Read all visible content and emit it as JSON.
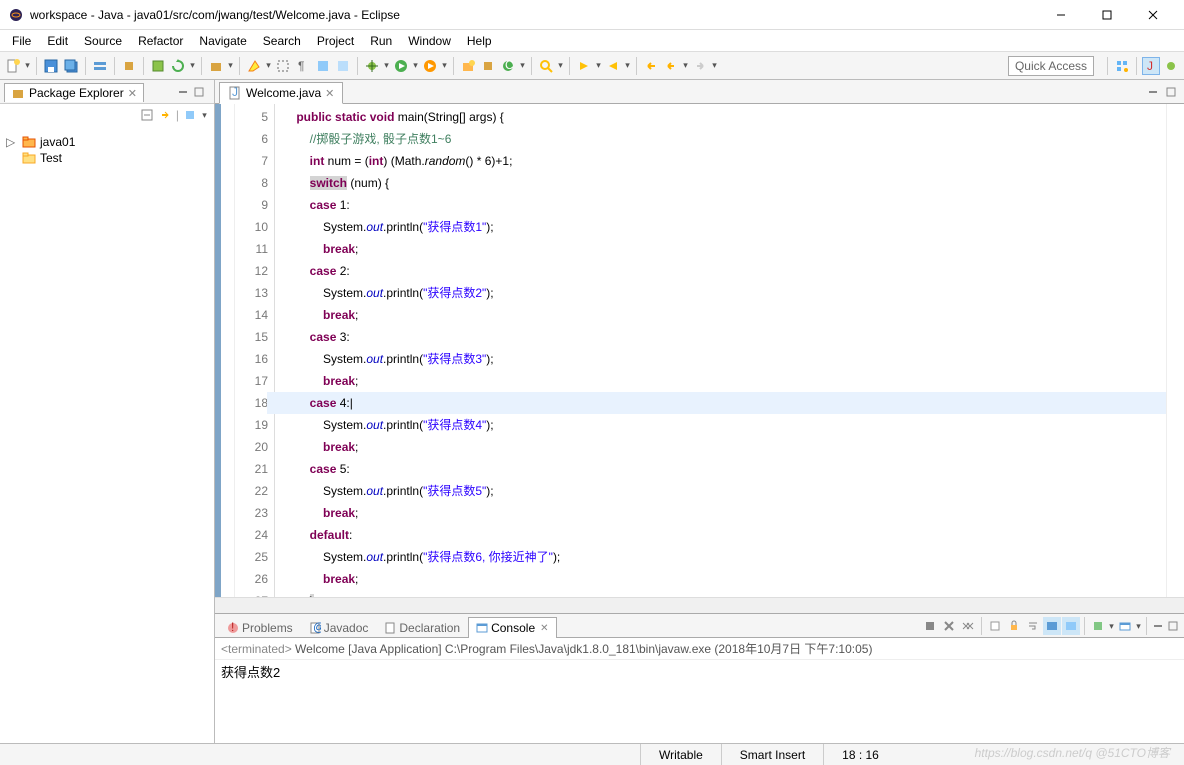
{
  "window": {
    "title": "workspace - Java - java01/src/com/jwang/test/Welcome.java - Eclipse"
  },
  "menu": [
    "File",
    "Edit",
    "Source",
    "Refactor",
    "Navigate",
    "Search",
    "Project",
    "Run",
    "Window",
    "Help"
  ],
  "quick_access": "Quick Access",
  "sidebar": {
    "view_title": "Package Explorer",
    "items": [
      {
        "label": "java01",
        "type": "project",
        "expandable": true
      },
      {
        "label": "Test",
        "type": "folder",
        "expandable": false
      }
    ]
  },
  "editor": {
    "tab_label": "Welcome.java",
    "first_line_no": 5,
    "highlighted_line_index": 13,
    "lines": [
      [
        {
          "k": "pad",
          "t": "    "
        },
        {
          "k": "kw",
          "t": "public"
        },
        {
          "k": "n",
          "t": " "
        },
        {
          "k": "kw",
          "t": "static"
        },
        {
          "k": "n",
          "t": " "
        },
        {
          "k": "kw",
          "t": "void"
        },
        {
          "k": "n",
          "t": " main(String[] args) {"
        }
      ],
      [
        {
          "k": "pad",
          "t": "        "
        },
        {
          "k": "cm",
          "t": "//掷骰子游戏, 骰子点数1~6"
        }
      ],
      [
        {
          "k": "pad",
          "t": "        "
        },
        {
          "k": "kw",
          "t": "int"
        },
        {
          "k": "n",
          "t": " num = ("
        },
        {
          "k": "kw",
          "t": "int"
        },
        {
          "k": "n",
          "t": ") (Math."
        },
        {
          "k": "mit",
          "t": "random"
        },
        {
          "k": "n",
          "t": "() * 6)+1;"
        }
      ],
      [
        {
          "k": "pad",
          "t": "        "
        },
        {
          "k": "kwhl",
          "t": "switch"
        },
        {
          "k": "n",
          "t": " (num) {"
        }
      ],
      [
        {
          "k": "pad",
          "t": "        "
        },
        {
          "k": "kw",
          "t": "case"
        },
        {
          "k": "n",
          "t": " 1:"
        }
      ],
      [
        {
          "k": "pad",
          "t": "            "
        },
        {
          "k": "n",
          "t": "System."
        },
        {
          "k": "field",
          "t": "out"
        },
        {
          "k": "n",
          "t": ".println("
        },
        {
          "k": "str",
          "t": "\"获得点数1\""
        },
        {
          "k": "n",
          "t": ");"
        }
      ],
      [
        {
          "k": "pad",
          "t": "            "
        },
        {
          "k": "kw",
          "t": "break"
        },
        {
          "k": "n",
          "t": ";"
        }
      ],
      [
        {
          "k": "pad",
          "t": "        "
        },
        {
          "k": "kw",
          "t": "case"
        },
        {
          "k": "n",
          "t": " 2:"
        }
      ],
      [
        {
          "k": "pad",
          "t": "            "
        },
        {
          "k": "n",
          "t": "System."
        },
        {
          "k": "field",
          "t": "out"
        },
        {
          "k": "n",
          "t": ".println("
        },
        {
          "k": "str",
          "t": "\"获得点数2\""
        },
        {
          "k": "n",
          "t": ");"
        }
      ],
      [
        {
          "k": "pad",
          "t": "            "
        },
        {
          "k": "kw",
          "t": "break"
        },
        {
          "k": "n",
          "t": ";"
        }
      ],
      [
        {
          "k": "pad",
          "t": "        "
        },
        {
          "k": "kw",
          "t": "case"
        },
        {
          "k": "n",
          "t": " 3:"
        }
      ],
      [
        {
          "k": "pad",
          "t": "            "
        },
        {
          "k": "n",
          "t": "System."
        },
        {
          "k": "field",
          "t": "out"
        },
        {
          "k": "n",
          "t": ".println("
        },
        {
          "k": "str",
          "t": "\"获得点数3\""
        },
        {
          "k": "n",
          "t": ");"
        }
      ],
      [
        {
          "k": "pad",
          "t": "            "
        },
        {
          "k": "kw",
          "t": "break"
        },
        {
          "k": "n",
          "t": ";"
        }
      ],
      [
        {
          "k": "pad",
          "t": "        "
        },
        {
          "k": "kw",
          "t": "case"
        },
        {
          "k": "n",
          "t": " 4:"
        }
      ],
      [
        {
          "k": "pad",
          "t": "            "
        },
        {
          "k": "n",
          "t": "System."
        },
        {
          "k": "field",
          "t": "out"
        },
        {
          "k": "n",
          "t": ".println("
        },
        {
          "k": "str",
          "t": "\"获得点数4\""
        },
        {
          "k": "n",
          "t": ");"
        }
      ],
      [
        {
          "k": "pad",
          "t": "            "
        },
        {
          "k": "kw",
          "t": "break"
        },
        {
          "k": "n",
          "t": ";"
        }
      ],
      [
        {
          "k": "pad",
          "t": "        "
        },
        {
          "k": "kw",
          "t": "case"
        },
        {
          "k": "n",
          "t": " 5:"
        }
      ],
      [
        {
          "k": "pad",
          "t": "            "
        },
        {
          "k": "n",
          "t": "System."
        },
        {
          "k": "field",
          "t": "out"
        },
        {
          "k": "n",
          "t": ".println("
        },
        {
          "k": "str",
          "t": "\"获得点数5\""
        },
        {
          "k": "n",
          "t": ");"
        }
      ],
      [
        {
          "k": "pad",
          "t": "            "
        },
        {
          "k": "kw",
          "t": "break"
        },
        {
          "k": "n",
          "t": ";"
        }
      ],
      [
        {
          "k": "pad",
          "t": "        "
        },
        {
          "k": "kw",
          "t": "default"
        },
        {
          "k": "n",
          "t": ":"
        }
      ],
      [
        {
          "k": "pad",
          "t": "            "
        },
        {
          "k": "n",
          "t": "System."
        },
        {
          "k": "field",
          "t": "out"
        },
        {
          "k": "n",
          "t": ".println("
        },
        {
          "k": "str",
          "t": "\"获得点数6, 你接近神了\""
        },
        {
          "k": "n",
          "t": ");"
        }
      ],
      [
        {
          "k": "pad",
          "t": "            "
        },
        {
          "k": "kw",
          "t": "break"
        },
        {
          "k": "n",
          "t": ";"
        }
      ],
      [
        {
          "k": "pad",
          "t": "        "
        },
        {
          "k": "nhl",
          "t": "}"
        }
      ]
    ]
  },
  "bottom": {
    "tabs": [
      {
        "label": "Problems",
        "active": false
      },
      {
        "label": "Javadoc",
        "active": false
      },
      {
        "label": "Declaration",
        "active": false
      },
      {
        "label": "Console",
        "active": true
      }
    ],
    "terminated_prefix": "<terminated>",
    "launch_info": " Welcome [Java Application] C:\\Program Files\\Java\\jdk1.8.0_181\\bin\\javaw.exe (2018年10月7日 下午7:10:05)",
    "output": "获得点数2"
  },
  "status": {
    "writable": "Writable",
    "insert": "Smart Insert",
    "pos": "18 : 16"
  },
  "watermark": "https://blog.csdn.net/q @51CTO博客"
}
